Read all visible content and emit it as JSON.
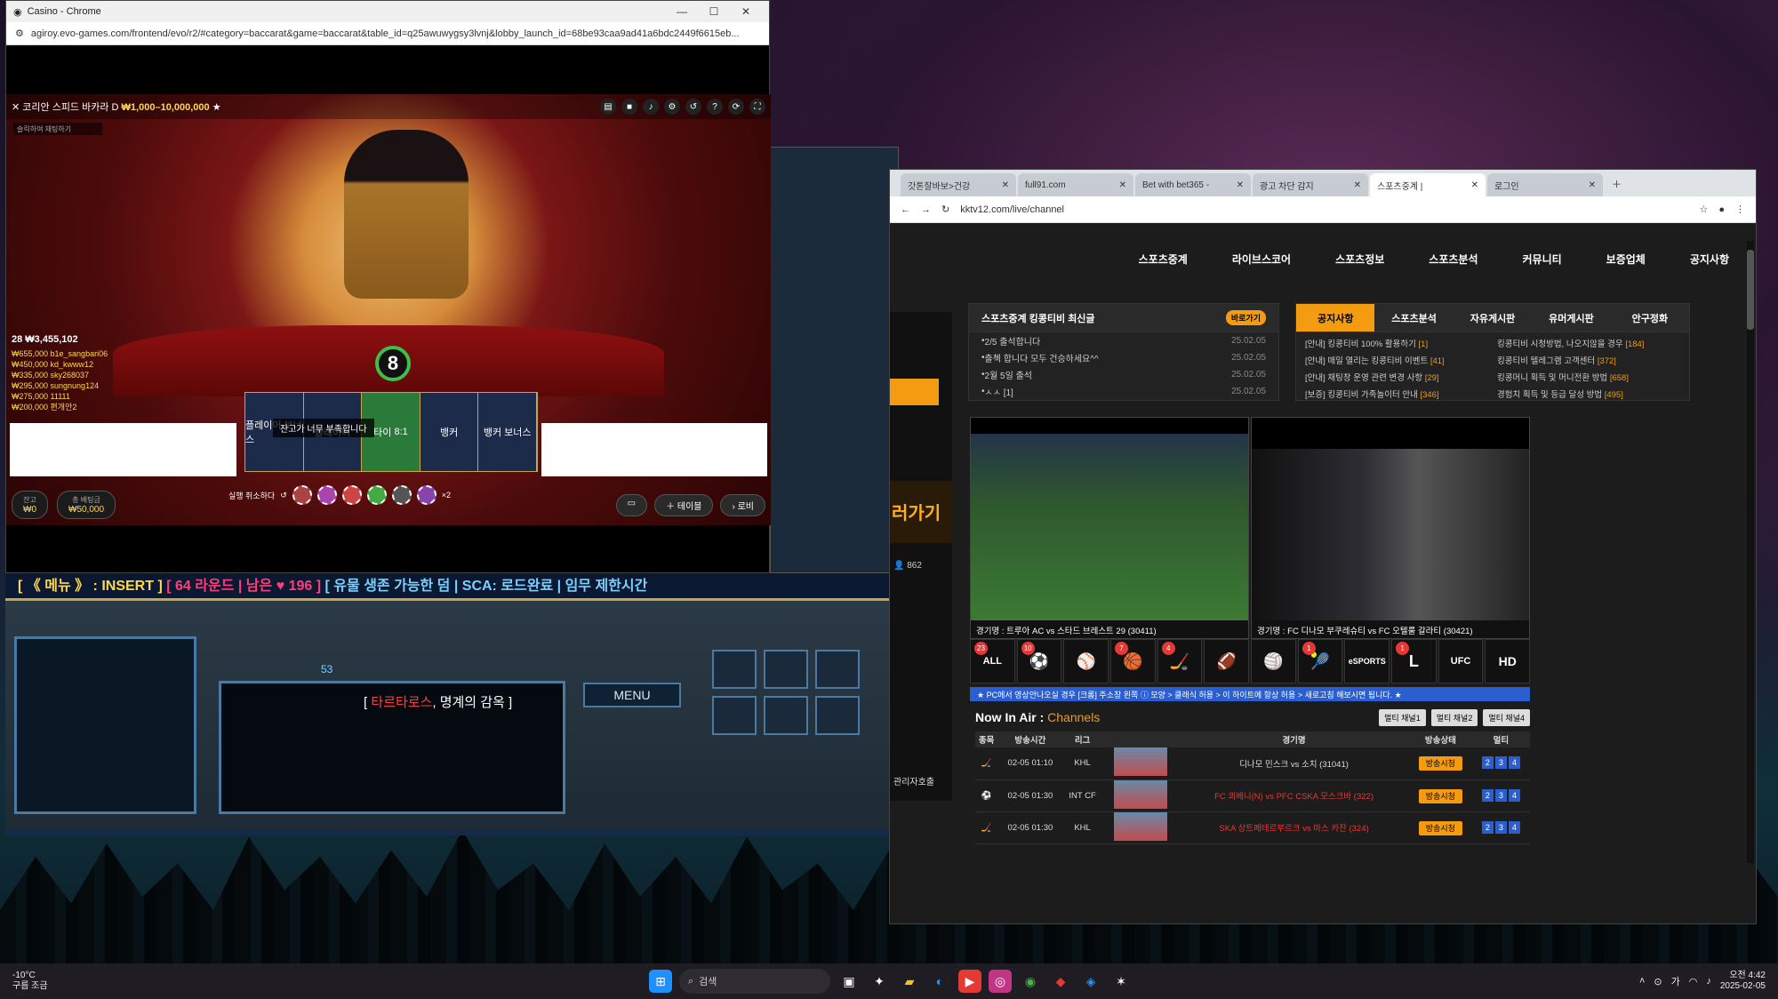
{
  "casino": {
    "window_title": "Casino - Chrome",
    "url": "agiroy.evo-games.com/frontend/evo/r2/#category=baccarat&game=baccarat&table_id=q25awuwygsy3lvnj&lobby_launch_id=68be93caa9ad41a6bdc2449f6615eb...",
    "table_name": "코리안 스피드 바카라 D",
    "table_limits": "₩1,000–10,000,000",
    "search_placeholder": "슬릭하여 채팅하기",
    "bettors_total": "28 ₩3,455,102",
    "bets": [
      "₩655,000 b1e_sangbari06",
      "₩450,000 kd_kwww12",
      "₩335,000 sky268037",
      "₩295,000 sungnung124",
      "₩275,000 11111",
      "₩200,000 편개안2"
    ],
    "countdown": "8",
    "bet_spots": [
      "플레이어 보너스",
      "플레이어",
      "타이",
      "뱅커",
      "뱅커 보너스"
    ],
    "tie_payout": "8:1",
    "toast": "잔고가 너무 부족합니다",
    "undo_label": "실행 취소하다",
    "x2_label": "×2",
    "balance_label": "잔고",
    "balance_value": "₩0",
    "totalbet_label": "총 베팅금",
    "totalbet_value": "₩50,000",
    "table_button": "테이블",
    "lobby_button": "로비"
  },
  "game": {
    "marquee_parts": [
      "[ 《 메뉴 》 : INSERT ]",
      "[ 64 라운드 | 남은 ♥ 196 ]",
      "[ 유물 생존 가능한 덤 | SCA: 로드완료 | 임무 제한시간"
    ],
    "unit_title_name": "타르타로스",
    "unit_title_rest": ", 명계의 감옥 ]",
    "unit_title_prefix": "[",
    "supply": "53",
    "menu": "MENU"
  },
  "kk": {
    "tabs": [
      "갓톤잘바보>건강",
      "full91.com",
      "Bet with bet365 -",
      "광고 차단 감지",
      "스포츠중계 |",
      "로그인"
    ],
    "url": "kktv12.com/live/channel",
    "nav": [
      "스포츠중계",
      "라이브스코어",
      "스포츠정보",
      "스포츠분석",
      "커뮤니티",
      "보증업체",
      "공지사항"
    ],
    "sidebar_banner": "러가기",
    "sidebar_viewers": "862",
    "sidebar_admin": "관리자호출",
    "news_title": "스포츠중계 킹콩티비 최신글",
    "news_more": "바로가기",
    "news": [
      {
        "t": "2/5 출석합니다",
        "d": "25.02.05"
      },
      {
        "t": "출첵 합니다 모두 건승하세요^^",
        "d": "25.02.05"
      },
      {
        "t": "2월 5일 출석",
        "d": "25.02.05"
      },
      {
        "t": "ㅅㅅ [1]",
        "d": "25.02.05"
      }
    ],
    "board_tabs": [
      "공지사항",
      "스포츠분석",
      "자유게시판",
      "유머게시판",
      "안구정화"
    ],
    "notices": [
      {
        "t": "[안내] 킹콩티비 100% 활용하기 ",
        "c": "[1]"
      },
      {
        "t": "킹콩티비 시청방법, 나오지않을 경우 ",
        "c": "[184]"
      },
      {
        "t": "[안내] 매일 열리는 킹콩티비 이벤트 ",
        "c": "[41]"
      },
      {
        "t": "킹콩티비 텔레그램 고객센터 ",
        "c": "[372]"
      },
      {
        "t": "[안내] 채팅창 운영 관련 변경 사항 ",
        "c": "[29]"
      },
      {
        "t": "킹콩머니 획득 및 머니전환 방법 ",
        "c": "[658]"
      },
      {
        "t": "[보증] 킹콩티비 가족놀이터 안내 ",
        "c": "[346]"
      },
      {
        "t": "경험치 획득 및 등급 달성 방법 ",
        "c": "[495]"
      }
    ],
    "video1_caption": "경기명 : 트루아 AC vs 스타드 브레스트 29 (30411)",
    "video2_caption": "경기명 : FC 디나모 부쿠레슈티 vs FC 오텔룰 갈라티 (30421)",
    "sport_icons": [
      {
        "g": "ALL",
        "b": "23"
      },
      {
        "g": "⚽",
        "b": "10"
      },
      {
        "g": "⚾",
        "b": ""
      },
      {
        "g": "🏀",
        "b": "7"
      },
      {
        "g": "🏒",
        "b": "4"
      },
      {
        "g": "🏈",
        "b": ""
      },
      {
        "g": "🏐",
        "b": ""
      },
      {
        "g": "🎾",
        "b": "1"
      },
      {
        "g": "eSPORTS",
        "b": ""
      },
      {
        "g": "L",
        "b": "1"
      },
      {
        "g": "UFC",
        "b": ""
      },
      {
        "g": "HD",
        "b": ""
      }
    ],
    "alert": "★ PC에서 영상안나오실 경우 [크롬] 주소창 왼쪽 ⓘ 모양 > 클래식 허용 > 이 하이트에 항상 허용 > 새로고침 해보시면 됩니다. ★",
    "now_in_air": "Now In Air : ",
    "channels": "Channels",
    "multi": [
      "멀티 채널1",
      "멀티 채널2",
      "멀티 채널4"
    ],
    "table_headers": [
      "종목",
      "방송시간",
      "리그",
      "",
      "경기명",
      "방송상태",
      "멀티"
    ],
    "rows": [
      {
        "icon": "🏒",
        "time": "02-05 01:10",
        "league": "KHL",
        "match": "디나모 민스크 vs 소치 (31041)",
        "red": false
      },
      {
        "icon": "⚽",
        "time": "02-05 01:30",
        "league": "INT CF",
        "match": "FC 쾨베니(N) vs PFC CSKA 모스크바 (322)",
        "red": true
      },
      {
        "icon": "🏒",
        "time": "02-05 01:30",
        "league": "KHL",
        "match": "SKA 상트페테르부르크 vs 마스 카잔 (324)",
        "red": true
      }
    ],
    "status_btn": "방송시청"
  },
  "taskbar": {
    "temp": "-10°C",
    "weather": "구름 조금",
    "search": "검색",
    "time": "오전 4:42",
    "date": "2025-02-05",
    "ime": "가"
  }
}
